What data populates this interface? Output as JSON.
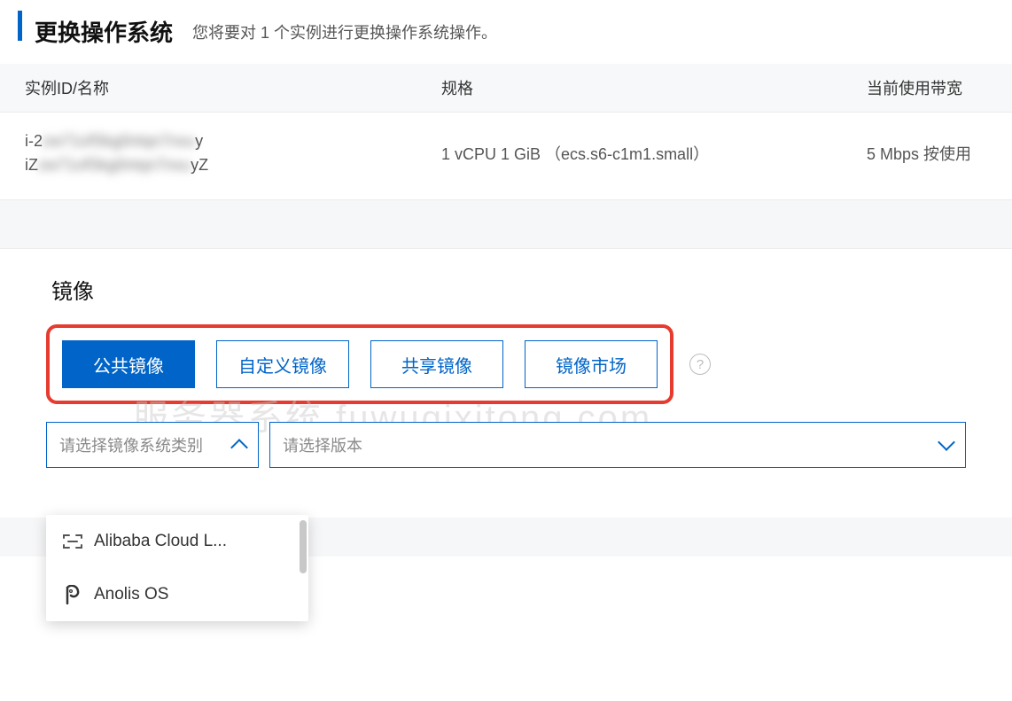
{
  "header": {
    "title": "更换操作系统",
    "subtitle": "您将要对 1 个实例进行更换操作系统操作。"
  },
  "table": {
    "headers": {
      "id": "实例ID/名称",
      "spec": "规格",
      "bandwidth": "当前使用带宽"
    },
    "row": {
      "id_prefix_1": "i-2",
      "id_blur_1": "zw71ofSkg0ntqn7nxu",
      "id_suffix_1": "y",
      "id_prefix_2": "iZ",
      "id_blur_2": "zw71ofSkg0ntqn7nxu",
      "id_suffix_2": "yZ",
      "spec": "1 vCPU 1 GiB （ecs.s6-c1m1.small）",
      "bandwidth": "5 Mbps 按使用"
    }
  },
  "image_section": {
    "title": "镜像",
    "tabs": [
      {
        "label": "公共镜像",
        "active": true
      },
      {
        "label": "自定义镜像",
        "active": false
      },
      {
        "label": "共享镜像",
        "active": false
      },
      {
        "label": "镜像市场",
        "active": false
      }
    ],
    "help": "?",
    "os_select_placeholder": "请选择镜像系统类别",
    "version_select_placeholder": "请选择版本",
    "watermark": "服务器系统 fuwuqixitong.com",
    "dropdown": [
      {
        "icon": "bracket-icon",
        "label": "Alibaba Cloud L..."
      },
      {
        "icon": "p-icon",
        "label": "Anolis OS"
      }
    ]
  }
}
